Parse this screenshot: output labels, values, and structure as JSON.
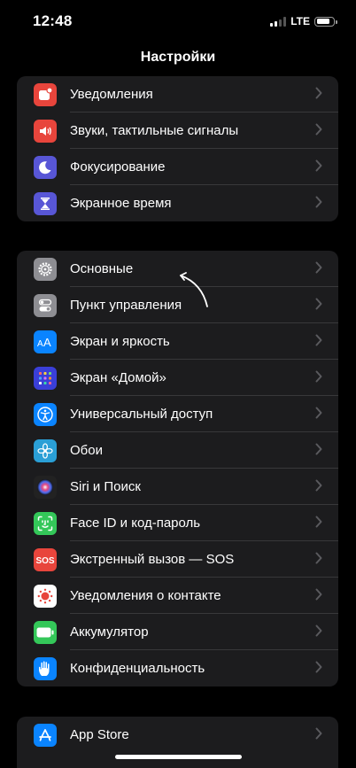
{
  "status": {
    "time": "12:48",
    "network": "LTE"
  },
  "nav": {
    "title": "Настройки"
  },
  "groups": [
    {
      "items": [
        {
          "label": "Уведомления",
          "icon": "notifications-icon",
          "color": "#e8453c"
        },
        {
          "label": "Звуки, тактильные сигналы",
          "icon": "sound-icon",
          "color": "#e8453c"
        },
        {
          "label": "Фокусирование",
          "icon": "moon-icon",
          "color": "#5856d6"
        },
        {
          "label": "Экранное время",
          "icon": "hourglass-icon",
          "color": "#5856d6"
        }
      ]
    },
    {
      "items": [
        {
          "label": "Основные",
          "icon": "gear-icon",
          "color": "#8e8e93"
        },
        {
          "label": "Пункт управления",
          "icon": "toggles-icon",
          "color": "#8e8e93"
        },
        {
          "label": "Экран и яркость",
          "icon": "text-size-icon",
          "color": "#0a84ff"
        },
        {
          "label": "Экран «Домой»",
          "icon": "home-grid-icon",
          "color": "#3a3fd8"
        },
        {
          "label": "Универсальный доступ",
          "icon": "accessibility-icon",
          "color": "#0a84ff"
        },
        {
          "label": "Обои",
          "icon": "flower-icon",
          "color": "#2a9fd6"
        },
        {
          "label": "Siri и Поиск",
          "icon": "siri-icon",
          "color": "#222222"
        },
        {
          "label": "Face ID и код-пароль",
          "icon": "face-id-icon",
          "color": "#34c759"
        },
        {
          "label": "Экстренный вызов — SOS",
          "icon": "sos-icon",
          "color": "#e8453c"
        },
        {
          "label": "Уведомления о контакте",
          "icon": "exposure-icon",
          "color": "#ffffff"
        },
        {
          "label": "Аккумулятор",
          "icon": "battery-icon",
          "color": "#34c759"
        },
        {
          "label": "Конфиденциальность",
          "icon": "hand-icon",
          "color": "#0a84ff"
        }
      ]
    },
    {
      "items": [
        {
          "label": "App Store",
          "icon": "app-store-icon",
          "color": "#0a84ff"
        }
      ]
    }
  ]
}
